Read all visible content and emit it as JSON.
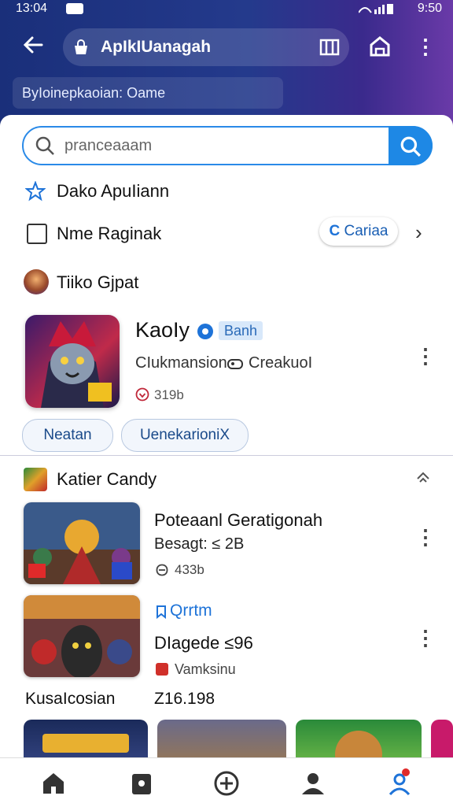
{
  "status_bar": {
    "time": "13:04",
    "right_time": "9:50"
  },
  "header": {
    "url_text": "ApIkIUanagah",
    "subtitle": "ByIoinepkaoian: Oame"
  },
  "search": {
    "placeholder": "pranceaaam"
  },
  "rows": {
    "row1_label": "Dako ApuIiann",
    "row2_label": "Nme Raginak",
    "row2_button": "Cariaa",
    "row3_label": "Tiiko Gjpat"
  },
  "featured": {
    "title": "KaoIy",
    "badge": "Banh",
    "subtitle": "CIukmansion",
    "subtitle2": "CreakuoI",
    "meta": "319b",
    "chips": [
      "Neatan",
      "UenekarioniX"
    ]
  },
  "section2": {
    "title": "Katier Candy",
    "cards": [
      {
        "title": "Poteaanl Geratigonah",
        "subtitle": "Besagt: ≤ 2B",
        "meta": "433b"
      },
      {
        "tag": "Qrrtm",
        "title": "DIagede ≤96",
        "meta": "Vamksinu"
      }
    ],
    "label": "KusaIcosian",
    "value": "Z16.198"
  },
  "colors": {
    "accent": "#1e88e5",
    "header_bg": "#1a2f7a"
  },
  "icons": [
    "back-icon",
    "lock-icon",
    "book-icon",
    "home-icon",
    "kebab-icon",
    "search-icon",
    "star-icon",
    "checkbox-icon",
    "refresh-icon",
    "chevron-right-icon",
    "verified-icon",
    "gamepad-icon",
    "heart-icon",
    "collapse-icon",
    "nav-home-icon",
    "nav-camera-icon",
    "nav-add-icon",
    "nav-user-icon",
    "nav-profile-icon"
  ]
}
